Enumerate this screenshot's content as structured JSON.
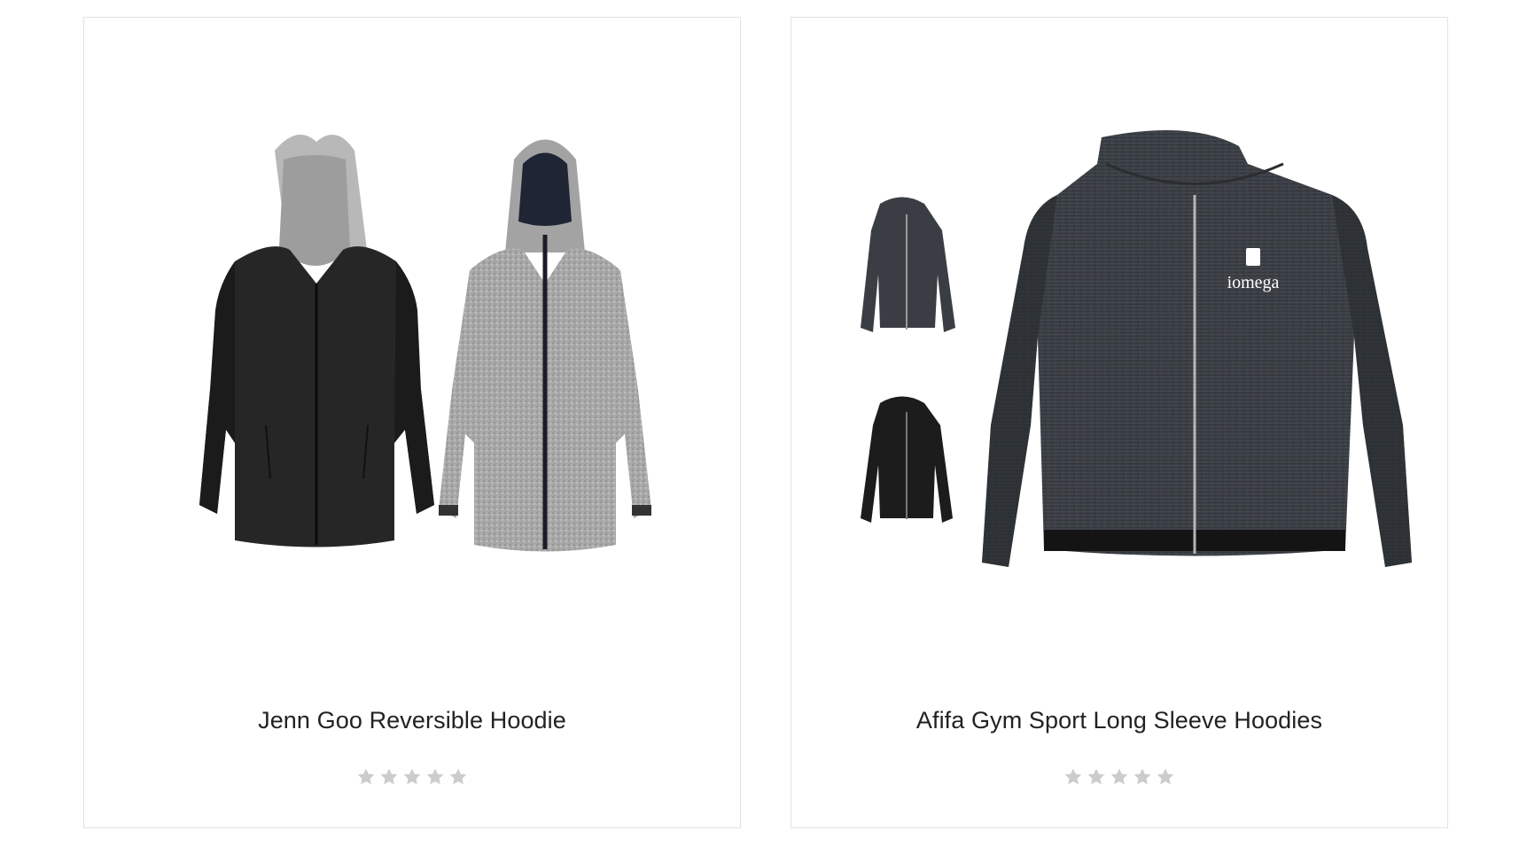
{
  "products": [
    {
      "title": "Jenn Goo Reversible Hoodie",
      "image_icon": "reversible-hoodie-image",
      "rating": {
        "value": 0,
        "max": 5
      }
    },
    {
      "title": "Afifa Gym Sport Long Sleeve Hoodies",
      "image_icon": "gym-hoodie-image",
      "logo_text": "iomega",
      "rating": {
        "value": 0,
        "max": 5
      }
    }
  ],
  "colors": {
    "star_empty": "#cccccc",
    "border": "#e3e3e3"
  }
}
